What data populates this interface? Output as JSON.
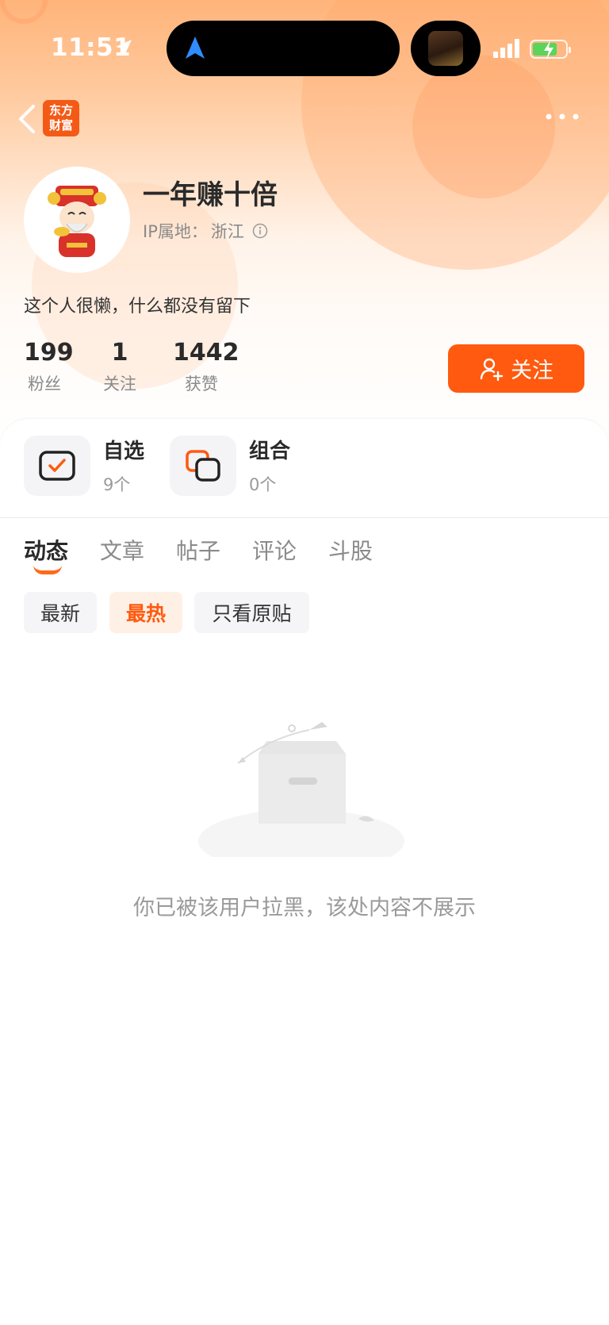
{
  "status_bar": {
    "time": "11:51"
  },
  "app": {
    "logo_text_line1": "东方",
    "logo_text_line2": "财富"
  },
  "profile": {
    "username": "一年赚十倍",
    "ip_label": "IP属地：",
    "ip_location": "浙江",
    "bio": "这个人很懒，什么都没有留下"
  },
  "stats": [
    {
      "value": "199",
      "label": "粉丝"
    },
    {
      "value": "1",
      "label": "关注"
    },
    {
      "value": "1442",
      "label": "获赞"
    }
  ],
  "follow_button": {
    "label": "关注"
  },
  "features": [
    {
      "title": "自选",
      "count": "9个"
    },
    {
      "title": "组合",
      "count": "0个"
    }
  ],
  "tabs": [
    {
      "label": "动态",
      "active": true
    },
    {
      "label": "文章",
      "active": false
    },
    {
      "label": "帖子",
      "active": false
    },
    {
      "label": "评论",
      "active": false
    },
    {
      "label": "斗股",
      "active": false
    }
  ],
  "filters": [
    {
      "label": "最新",
      "active": false
    },
    {
      "label": "最热",
      "active": true
    },
    {
      "label": "只看原贴",
      "active": false
    }
  ],
  "empty_state": {
    "message": "你已被该用户拉黑，该处内容不展示"
  },
  "colors": {
    "accent": "#ff5a0f",
    "logo_bg": "#f45a16"
  }
}
